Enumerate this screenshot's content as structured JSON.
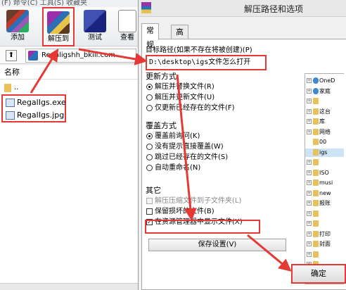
{
  "winrar": {
    "menubar": "(F)   命令(C)   工具(S)   收藏夹",
    "toolbar": [
      {
        "label": "添加",
        "icon": "add-archive-icon"
      },
      {
        "label": "解压到",
        "icon": "extract-to-icon"
      },
      {
        "label": "测试",
        "icon": "test-icon"
      },
      {
        "label": "查看",
        "icon": "view-icon"
      }
    ],
    "address": "Regaligshh_bkill.com",
    "column_header": "名称",
    "parent_folder": "..",
    "files": [
      {
        "name": "RegalIgs.exe"
      },
      {
        "name": "RegalIgs.jpg"
      }
    ]
  },
  "dialog": {
    "title": "解压路径和选项",
    "tabs": [
      "常规",
      "高级"
    ],
    "target_label": "目标路径(如果不存在将被创建)(P)",
    "target_value": "D:\\desktop\\igs文件怎么打开",
    "update_group": {
      "title": "更新方式",
      "options": [
        {
          "label": "解压并替换文件(R)",
          "selected": true
        },
        {
          "label": "解压并更新文件(U)",
          "selected": false
        },
        {
          "label": "仅更新已经存在的文件(F)",
          "selected": false
        }
      ]
    },
    "overwrite_group": {
      "title": "覆盖方式",
      "options": [
        {
          "label": "覆盖前询问(K)",
          "selected": true
        },
        {
          "label": "没有提示直接覆盖(W)",
          "selected": false
        },
        {
          "label": "跳过已经存在的文件(S)",
          "selected": false
        },
        {
          "label": "自动重命名(N)",
          "selected": false
        }
      ]
    },
    "other_group": {
      "title": "其它",
      "options": [
        {
          "label": "解压压缩文件到子文件夹(L)",
          "checked": false,
          "disabled": true
        },
        {
          "label": "保留损坏的文件(B)",
          "checked": false,
          "disabled": false
        },
        {
          "label": "在资源管理器中显示文件(X)",
          "checked": true,
          "disabled": false
        }
      ]
    },
    "save_settings": "保存设置(V)",
    "ok": "确定",
    "tree": [
      {
        "label": "OneD",
        "kind": "cloud",
        "expander": "+"
      },
      {
        "label": "家庭",
        "kind": "cloud",
        "expander": "+"
      },
      {
        "label": "",
        "kind": "folder",
        "expander": "+"
      },
      {
        "label": "这台",
        "kind": "folder",
        "expander": "+"
      },
      {
        "label": "库",
        "kind": "folder",
        "expander": "+"
      },
      {
        "label": "网络",
        "kind": "folder",
        "expander": "+"
      },
      {
        "label": "00",
        "kind": "folder",
        "expander": ""
      },
      {
        "label": "igs",
        "kind": "folder",
        "expander": "",
        "selected": true
      },
      {
        "label": "",
        "kind": "folder",
        "expander": "+"
      },
      {
        "label": "ISO",
        "kind": "folder",
        "expander": "+"
      },
      {
        "label": "musi",
        "kind": "folder",
        "expander": "+"
      },
      {
        "label": "new",
        "kind": "folder",
        "expander": "+"
      },
      {
        "label": "报账",
        "kind": "folder",
        "expander": "+"
      },
      {
        "label": "",
        "kind": "folder",
        "expander": "+"
      },
      {
        "label": "",
        "kind": "folder",
        "expander": "+"
      },
      {
        "label": "打印",
        "kind": "folder",
        "expander": "+"
      },
      {
        "label": "封面",
        "kind": "folder",
        "expander": "+"
      },
      {
        "label": "",
        "kind": "folder",
        "expander": "+"
      },
      {
        "label": "",
        "kind": "folder",
        "expander": "+"
      },
      {
        "label": "",
        "kind": "folder",
        "expander": "+"
      }
    ]
  },
  "colors": {
    "annotation": "#e53935",
    "selection": "#cde3f7"
  }
}
